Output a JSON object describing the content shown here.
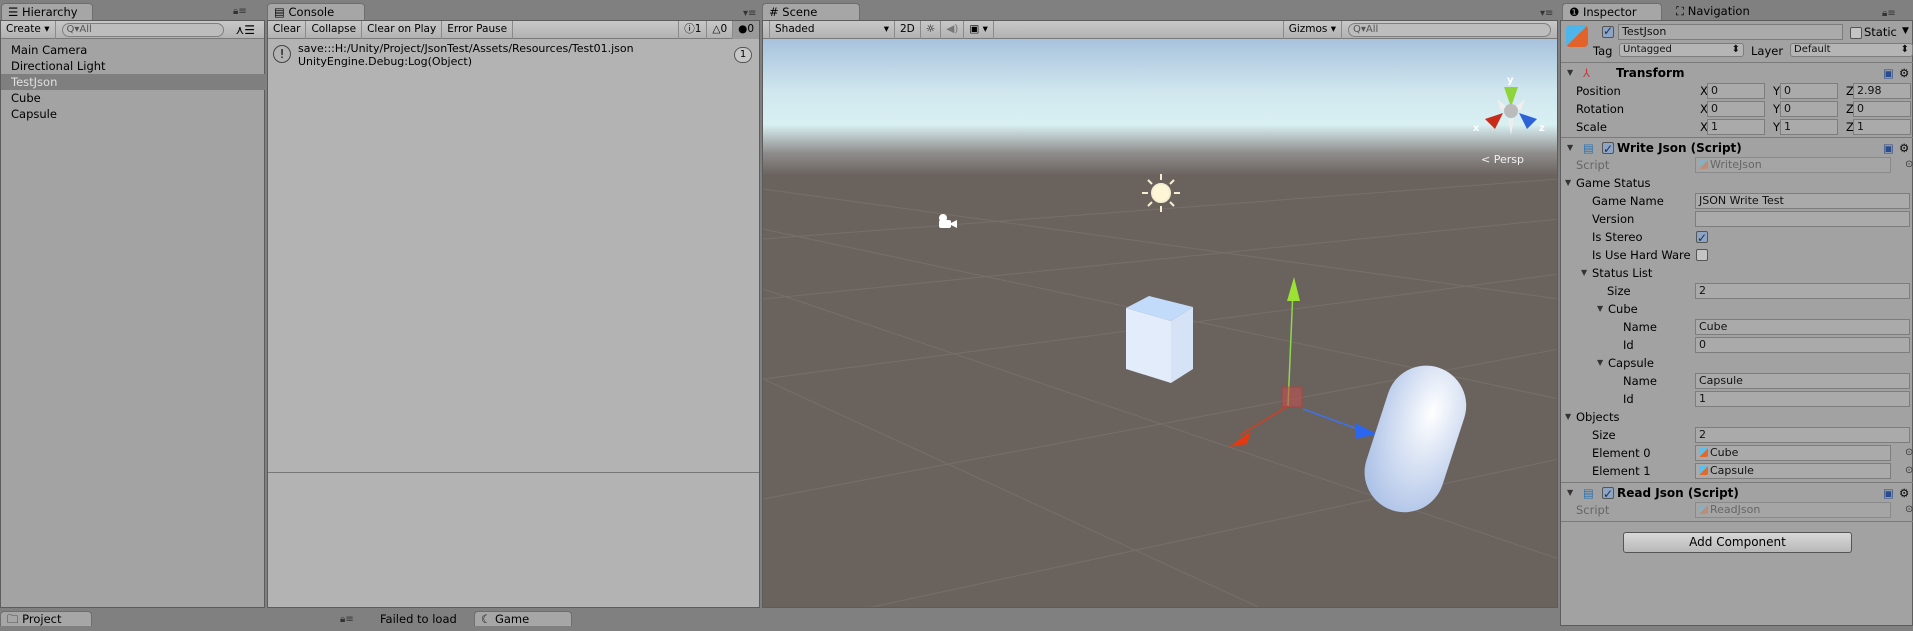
{
  "hierarchy": {
    "tab": "Hierarchy",
    "create": "Create",
    "search_placeholder": "All",
    "items": [
      "Main Camera",
      "Directional Light",
      "TestJson",
      "Cube",
      "Capsule"
    ],
    "selected": "TestJson"
  },
  "console": {
    "tab": "Console",
    "buttons": [
      "Clear",
      "Collapse",
      "Clear on Play",
      "Error Pause"
    ],
    "counts": {
      "info": "1",
      "warning": "0",
      "error": "0"
    },
    "log": {
      "line1": "save:::H:/Unity/Project/JsonTest/Assets/Resources/Test01.json",
      "line2": "UnityEngine.Debug:Log(Object)",
      "count": "1"
    }
  },
  "scene": {
    "tab": "Scene",
    "shading": "Shaded",
    "mode_2d": "2D",
    "gizmos": "Gizmos",
    "search_placeholder": "All",
    "projection": "Persp",
    "axes": {
      "x": "x",
      "y": "y",
      "z": "z"
    }
  },
  "inspector": {
    "tab": "Inspector",
    "nav_tab": "Navigation",
    "object_name": "TestJson",
    "static_label": "Static",
    "tag_label": "Tag",
    "tag": "Untagged",
    "layer_label": "Layer",
    "layer": "Default",
    "transform": {
      "title": "Transform",
      "rows": [
        {
          "label": "Position",
          "x": "0",
          "y": "0",
          "z": "2.98"
        },
        {
          "label": "Rotation",
          "x": "0",
          "y": "0",
          "z": "0"
        },
        {
          "label": "Scale",
          "x": "1",
          "y": "1",
          "z": "1"
        }
      ]
    },
    "write_json": {
      "title": "Write Json (Script)",
      "script_label": "Script",
      "script": "WriteJson",
      "game_status": "Game Status",
      "game_name_label": "Game Name",
      "game_name": "JSON Write Test",
      "version_label": "Version",
      "version": "",
      "is_stereo_label": "Is Stereo",
      "is_stereo": true,
      "hardware_label": "Is Use Hard Ware",
      "hardware": false,
      "status_list": "Status List",
      "size_label": "Size",
      "size": "2",
      "items": [
        {
          "header": "Cube",
          "name_label": "Name",
          "name": "Cube",
          "id_label": "Id",
          "id": "0"
        },
        {
          "header": "Capsule",
          "name_label": "Name",
          "name": "Capsule",
          "id_label": "Id",
          "id": "1"
        }
      ],
      "objects": "Objects",
      "objects_size_label": "Size",
      "objects_size": "2",
      "elements": [
        {
          "label": "Element 0",
          "value": "Cube"
        },
        {
          "label": "Element 1",
          "value": "Capsule"
        }
      ]
    },
    "read_json": {
      "title": "Read Json (Script)",
      "script_label": "Script",
      "script": "ReadJson"
    },
    "add_component": "Add Component"
  },
  "bottom": {
    "project_tab": "Project",
    "status": "Failed to load",
    "game_tab": "Game"
  }
}
